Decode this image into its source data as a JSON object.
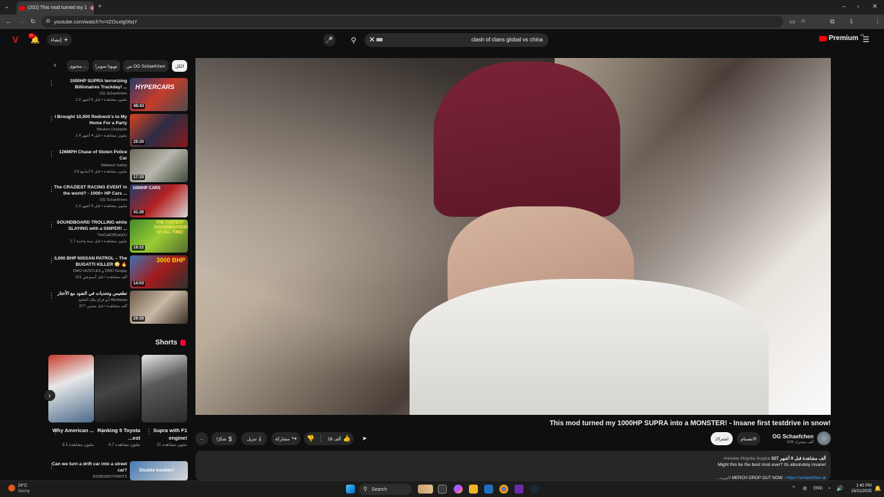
{
  "browser": {
    "tab_title": "(202) This mod turned my 1",
    "url": "youtube.com/watch?v=tZOuxtg06qY"
  },
  "header": {
    "create_label": "إنشاء",
    "notifications_count": "9+",
    "search_query": "clash of clans global vs china",
    "premium_label": "Premium",
    "premium_region": "AE"
  },
  "chips": {
    "all": "الكل",
    "from_channel": "من OG Schaefchen",
    "toyota": "تويوتا سوبرا",
    "related": "محتوى ..."
  },
  "related": [
    {
      "title": "1000HP SUPRA terrorizing Billionaires Trackday! ...",
      "channel": "OG Schaefchen",
      "meta": "1.2 مليون مشاهدة • قبل 6 أشهر",
      "duration": "48:43",
      "thumb_text": "HYPERCARS"
    },
    {
      "title": "I Brought 10,000 Redneck's to My Home For a Party",
      "channel": "Westen Champlin",
      "meta": "1.4 مليون مشاهدة • قبل 4 أشهر",
      "duration": "29:20",
      "thumb_text": ""
    },
    {
      "title": "126MPH Chase of Stolen Police Car",
      "channel": "Midwest Safety",
      "meta": "3.6 مليون مشاهدة • قبل 5 أسابيع",
      "duration": "17:33",
      "thumb_text": ""
    },
    {
      "title": "The CRAZIEST RACING EVENT in the world? - 1000+ HP Cars ...",
      "channel": "OG Schaefchen",
      "meta": "1.3 مليون مشاهدة • قبل 9 أشهر",
      "duration": "41:26",
      "thumb_text": "1000HP CARS"
    },
    {
      "title": "SOUNDBOARD TROLLING while SLAYING with a SNIPER! ...",
      "channel": "TheCallOfDutyDJ",
      "meta": "1.7 مليون مشاهدة • قبل سنة واحدة",
      "duration": "19:22",
      "thumb_text": "THE FASTEST SOUNDBOARDER OF ALL TIME!"
    },
    {
      "title": "3,000 BHP NISSAN PATROL – The BUGATTI KILLER 😳 🔥",
      "channel": "DMO HUSTLES و DMO Deejay",
      "meta": "151 ألف مشاهدة • قبل أسبوعين",
      "duration": "14:03",
      "thumb_text": "3000 BHP"
    },
    {
      "title": "تطعيس وتحديات في النفود مع الأحتار",
      "channel": "أبو فزاع ملك الخليج Abofazaa",
      "meta": "877 ألف مشاهدة • قبل سنتين",
      "duration": "29:56",
      "thumb_text": ""
    }
  ],
  "shorts": {
    "heading": "Shorts",
    "items": [
      {
        "title": "Why American ...",
        "views": "3.1 مليون مشاهدة"
      },
      {
        "title": "Ranking 5 Toyota ...est",
        "views": "4.7 مليون مشاهدة"
      },
      {
        "title": "Supra with F1 engine!",
        "views": "11 مليون مشاهدة"
      }
    ]
  },
  "next_related": {
    "title": "Can we turn a drift car into a street car?",
    "channel": "B32BIGBOYPANTS",
    "thumb_text": "Double trouble!!"
  },
  "video": {
    "title": "This mod turned my 1000HP SUPRA into a MONSTER! - Insane first testdrive in snow!",
    "channel": "OG Schaefchen",
    "subscribers": "678 ألف مشترك",
    "join_label": "الانضمام",
    "subscribe_label": "اشتراك",
    "likes": "18 ألف",
    "share_label": "مشاركة",
    "download_label": "تنزيل",
    "thanks_label": "شكرًا",
    "more_label": "..."
  },
  "description": {
    "stats": "327 ألف مشاهدة  قبل 9 أشهر",
    "tags": "#review #toyota #supra",
    "line1": "Might this be the best mod ever? Its absolutely insane!",
    "merch_prefix": "MERCH DROP OUT NOW - ",
    "merch_link": "https://schaefchen.at",
    "more": "...المزيد"
  },
  "taskbar": {
    "temp": "28°C",
    "weather": "Sunny",
    "search_label": "Search",
    "lang": "ENG",
    "time": "1:40 PM",
    "date": "15/11/2025"
  }
}
